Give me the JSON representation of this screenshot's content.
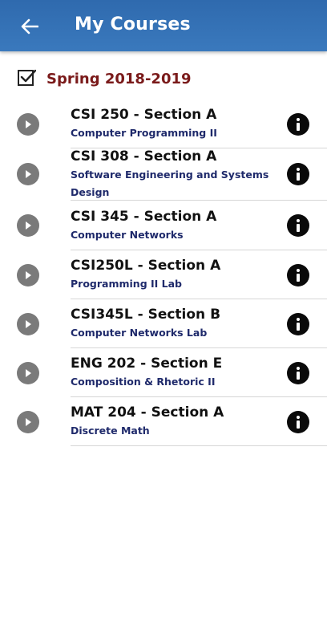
{
  "header": {
    "title": "My Courses",
    "back_icon": "arrow-left-icon",
    "bg_color": "#3571b5"
  },
  "term": {
    "label": "Spring 2018-2019",
    "icon": "checkbox-checked-icon",
    "color": "#7a1a1a"
  },
  "courses": [
    {
      "code": "CSI 250 - Section A",
      "name": "Computer Programming II"
    },
    {
      "code": "CSI 308 - Section A",
      "name": "Software Engineering and Systems Design"
    },
    {
      "code": "CSI 345 - Section A",
      "name": "Computer Networks"
    },
    {
      "code": "CSI250L - Section A",
      "name": "Programming II Lab"
    },
    {
      "code": "CSI345L - Section B",
      "name": "Computer Networks Lab"
    },
    {
      "code": "ENG 202 - Section E",
      "name": "Composition & Rhetoric II"
    },
    {
      "code": "MAT 204 - Section A",
      "name": "Discrete Math"
    }
  ]
}
